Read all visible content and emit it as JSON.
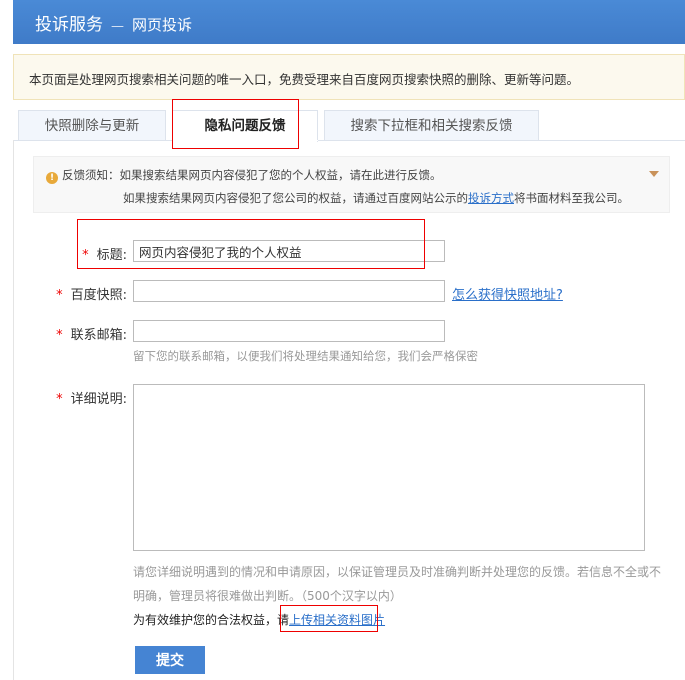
{
  "header": {
    "title": "投诉服务",
    "separator": "—",
    "subtitle": "网页投诉"
  },
  "notice": "本页面是处理网页搜索相关问题的唯一入口，免费受理来自百度网页搜索快照的删除、更新等问题。",
  "tabs": [
    {
      "label": "快照删除与更新"
    },
    {
      "label": "隐私问题反馈",
      "active": true
    },
    {
      "label": "搜索下拉框和相关搜索反馈"
    }
  ],
  "tip": {
    "title": "反馈须知：",
    "line1": "如果搜索结果网页内容侵犯了您的个人权益，请在此进行反馈。",
    "line2_pre": "如果搜索结果网页内容侵犯了您公司的权益，请通过百度网站公示的",
    "line2_link": "投诉方式",
    "line2_post": "将书面材料至我公司。"
  },
  "form": {
    "required_mark": "*",
    "title_label": "标题:",
    "title_value": "网页内容侵犯了我的个人权益",
    "snapshot_label": "百度快照:",
    "snapshot_value": "",
    "snapshot_help": "怎么获得快照地址?",
    "email_label": "联系邮箱:",
    "email_value": "",
    "email_hint": "留下您的联系邮箱，以便我们将处理结果通知给您，我们会严格保密",
    "detail_label": "详细说明:",
    "detail_value": "",
    "detail_hint1": "请您详细说明遇到的情况和申请原因，以保证管理员及时准确判断并处理您的反馈。若信息不全或不",
    "detail_hint2": "明确，管理员将很难做出判断。（500个汉字以内）",
    "upload_pre": "为有效维护您的合法权益，请",
    "upload_link": "上传相关资料图片",
    "submit": "提交"
  }
}
